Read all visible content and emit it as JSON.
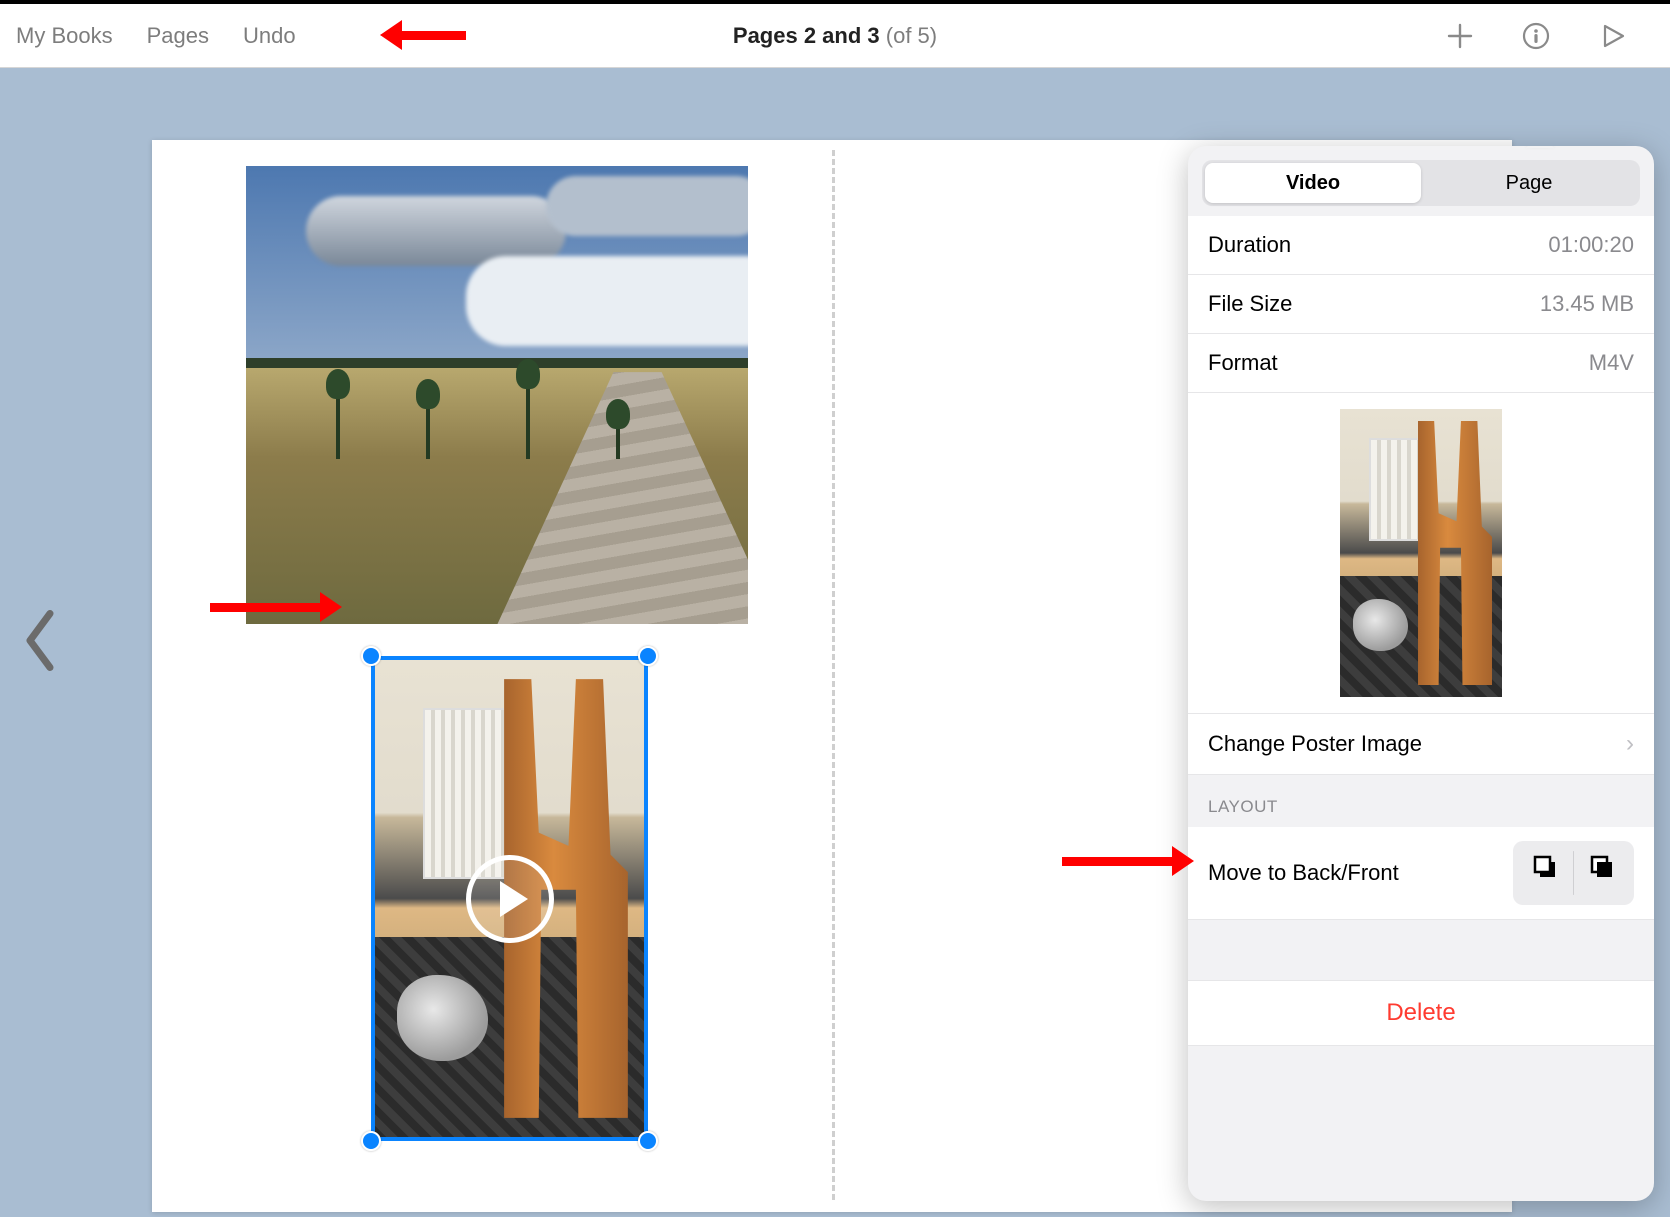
{
  "toolbar": {
    "my_books": "My Books",
    "pages": "Pages",
    "undo": "Undo",
    "title_bold": "Pages 2 and 3",
    "title_rest": " (of 5)"
  },
  "inspector": {
    "tabs": {
      "video": "Video",
      "page": "Page"
    },
    "duration_label": "Duration",
    "duration_value": "01:00:20",
    "filesize_label": "File Size",
    "filesize_value": "13.45 MB",
    "format_label": "Format",
    "format_value": "M4V",
    "change_poster": "Change Poster Image",
    "layout_header": "LAYOUT",
    "move_layer": "Move to Back/Front",
    "delete": "Delete"
  }
}
